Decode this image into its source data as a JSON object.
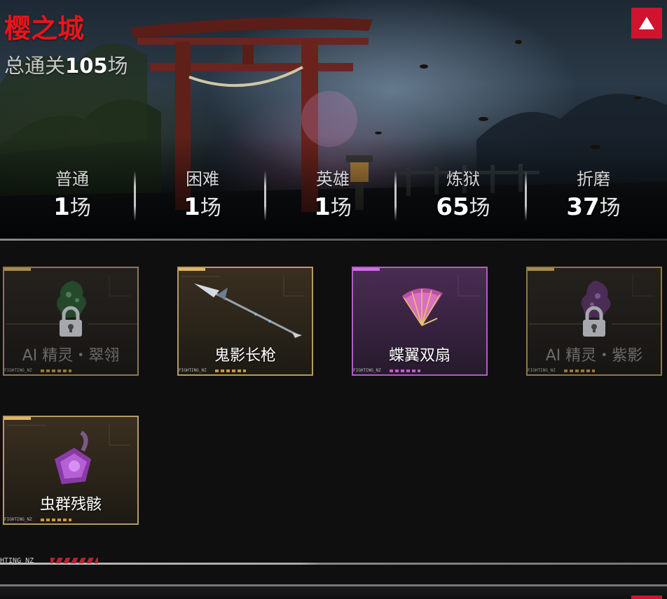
{
  "map": {
    "title": "樱之城",
    "total_prefix": "总通关",
    "total_count": "105",
    "total_suffix": "场"
  },
  "stats": [
    {
      "label": "普通",
      "count": "1",
      "unit": "场"
    },
    {
      "label": "困难",
      "count": "1",
      "unit": "场"
    },
    {
      "label": "英雄",
      "count": "1",
      "unit": "场"
    },
    {
      "label": "炼狱",
      "count": "65",
      "unit": "场"
    },
    {
      "label": "折磨",
      "count": "37",
      "unit": "场"
    }
  ],
  "rewards": [
    {
      "name": "AI 精灵・翠翎",
      "rarity": "gold",
      "locked": true,
      "icon": "green-spirit-icon"
    },
    {
      "name": "鬼影长枪",
      "rarity": "gold",
      "locked": false,
      "icon": "spear-icon"
    },
    {
      "name": "蝶翼双扇",
      "rarity": "purple",
      "locked": false,
      "icon": "fan-icon"
    },
    {
      "name": "AI 精灵・紫影",
      "rarity": "gold",
      "locked": true,
      "icon": "purple-spirit-icon"
    },
    {
      "name": "虫群残骸",
      "rarity": "gold",
      "locked": false,
      "icon": "swarm-remains-icon"
    }
  ],
  "card_tag": "FIGHTING_NZ",
  "footer_tag": "HTING_NZ",
  "colors": {
    "title_red": "#e8151b",
    "button_red": "#d0132f",
    "gold_border": "#b89b5e",
    "purple_border": "#b25cc6"
  }
}
